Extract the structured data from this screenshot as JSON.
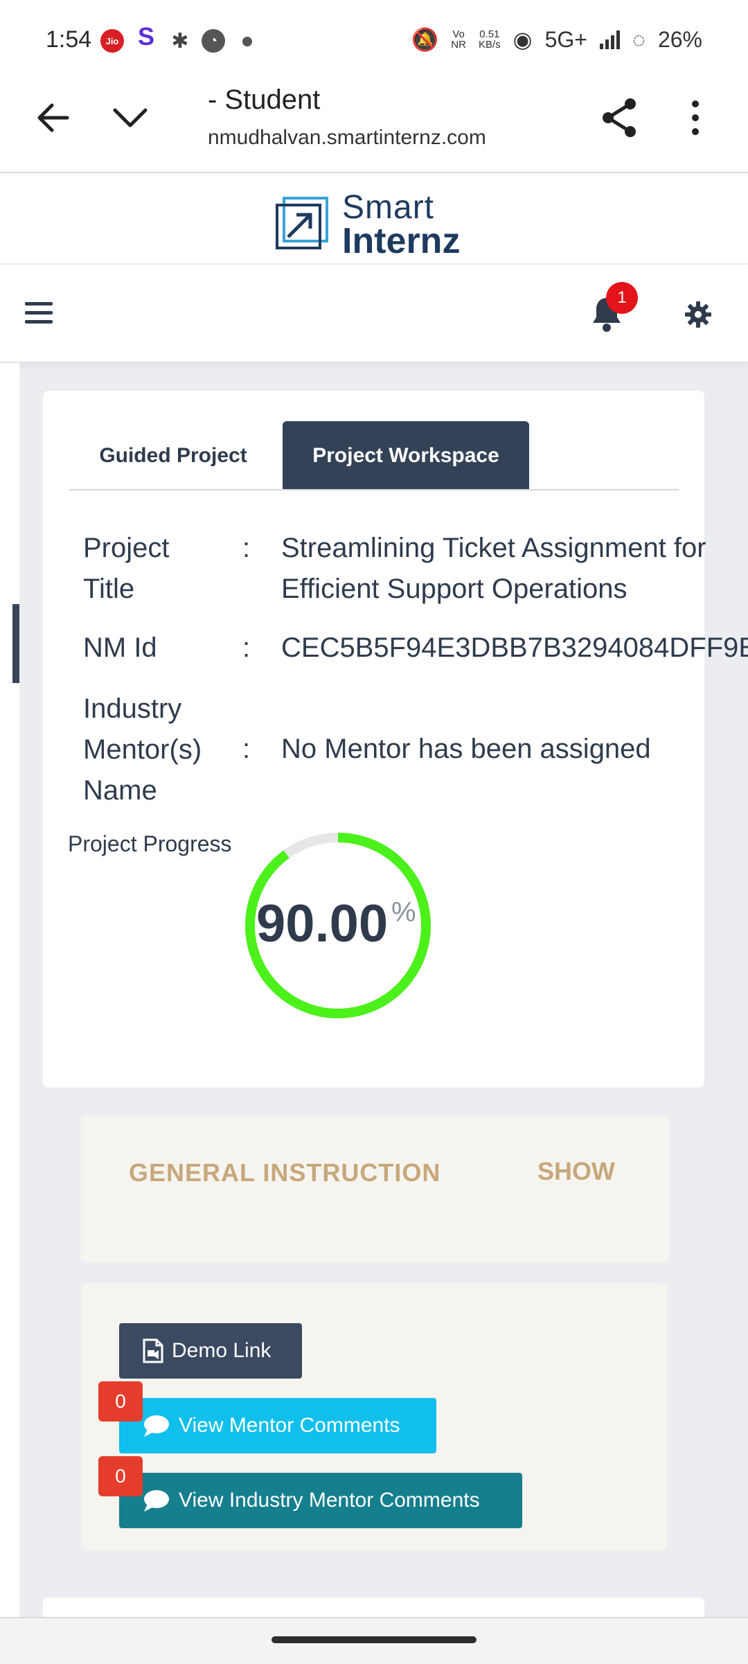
{
  "status_bar": {
    "time": "1:54",
    "jio_label": "Jio",
    "s_label": "S",
    "volte_top": "Vo",
    "volte_bottom": "NR",
    "speed_top": "0.51",
    "speed_bottom": "KB/s",
    "network": "5G+",
    "battery": "26%"
  },
  "browser": {
    "title": "- Student",
    "url": "nmudhalvan.smartinternz.com"
  },
  "site": {
    "logo_line1": "Smart",
    "logo_line2": "Internz",
    "notification_count": "1"
  },
  "tabs": {
    "guided": "Guided Project",
    "workspace": "Project Workspace"
  },
  "project": {
    "title_label_1": "Project",
    "title_label_2": "Title",
    "title_value_1": "Streamlining Ticket Assignment for",
    "title_value_2": "Efficient Support Operations",
    "nm_label": "NM Id",
    "nm_value": "CEC5B5F94E3DBB7B3294084DFF9E",
    "mentor_label_1": "Industry",
    "mentor_label_2": "Mentor(s)",
    "mentor_label_3": "Name",
    "mentor_value": "No Mentor has been assigned",
    "colon": ":"
  },
  "progress": {
    "label": "Project Progress",
    "value": "90.00",
    "unit": "%",
    "fraction": 0.9,
    "color": "#4cf01a",
    "track_color": "#e6e6e6"
  },
  "instruction": {
    "title": "GENERAL INSTRUCTION",
    "toggle": "SHOW"
  },
  "actions": {
    "demo": "Demo Link",
    "mentor_comments": "View Mentor Comments",
    "industry_comments": "View Industry Mentor Comments",
    "mentor_count": "0",
    "industry_count": "0"
  }
}
